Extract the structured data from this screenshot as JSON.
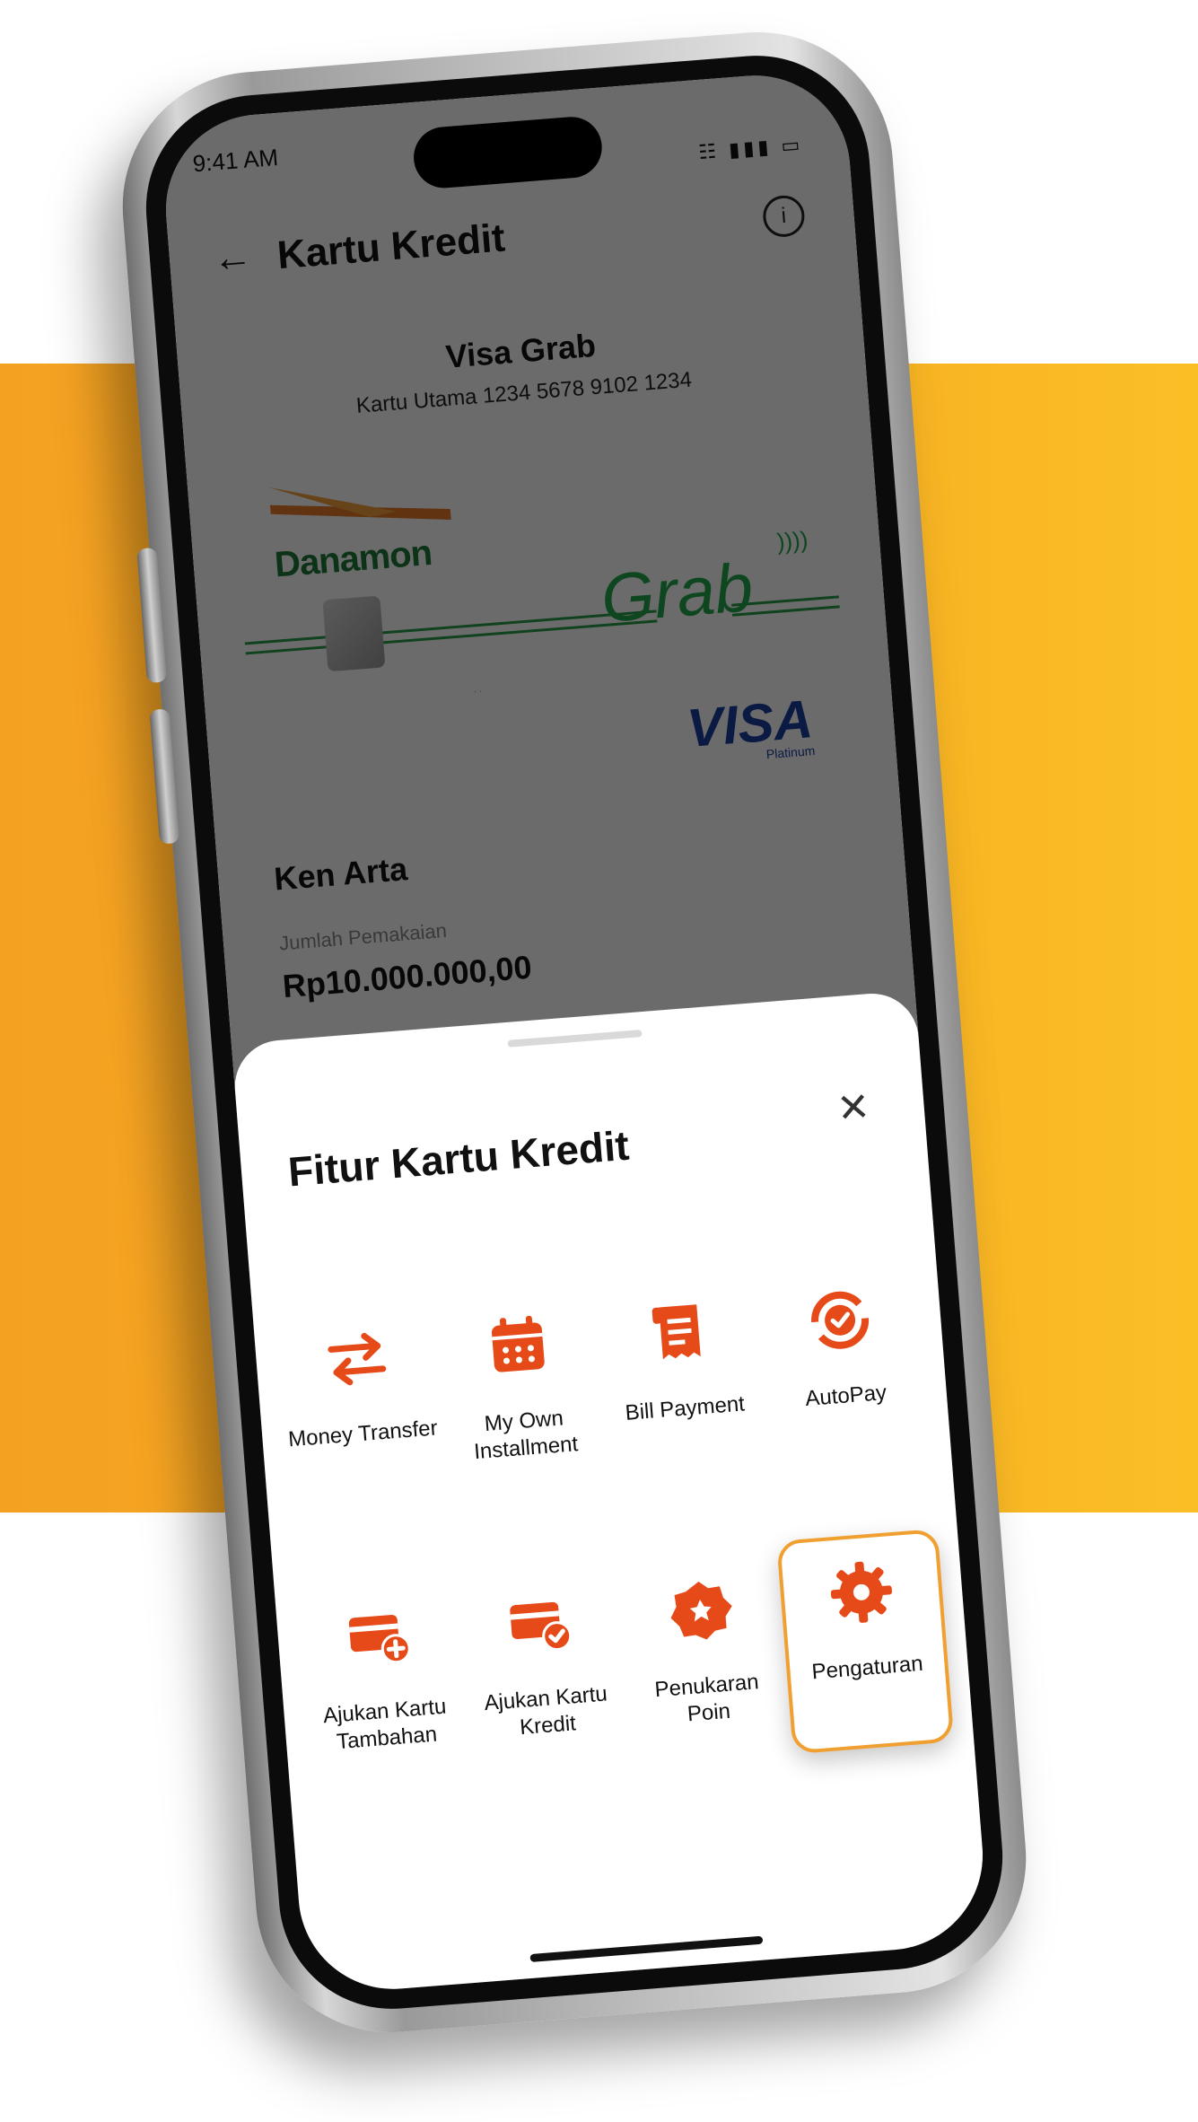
{
  "colors": {
    "accent": "#e64a19",
    "highlight": "#f0a030",
    "background": "#f7ab20"
  },
  "status_bar": {
    "time": "9:41 AM",
    "icons": "wifi-signal-battery"
  },
  "header": {
    "title": "Kartu Kredit",
    "back_icon": "back-arrow-icon",
    "info_icon": "info-icon"
  },
  "card": {
    "name": "Visa Grab",
    "number": "Kartu Utama 1234 5678 9102 1234",
    "bank_logo_text": "Danamon",
    "partner_logo_text": "Grab",
    "network_logo_text": "VISA",
    "network_tier": "Platinum"
  },
  "account": {
    "holder": "Ken Arta",
    "usage_label": "Jumlah Pemakaian",
    "usage_value": "Rp10.000.000,00"
  },
  "sheet": {
    "title": "Fitur Kartu Kredit",
    "close_icon": "close-icon",
    "features": [
      {
        "label": "Money Transfer",
        "icon": "transfer-arrows-icon"
      },
      {
        "label": "My Own\nInstallment",
        "icon": "calendar-icon"
      },
      {
        "label": "Bill Payment",
        "icon": "receipt-icon"
      },
      {
        "label": "AutoPay",
        "icon": "autopay-icon"
      },
      {
        "label": "Ajukan Kartu\nTambahan",
        "icon": "add-card-icon"
      },
      {
        "label": "Ajukan Kartu\nKredit",
        "icon": "card-check-icon"
      },
      {
        "label": "Penukaran\nPoin",
        "icon": "badge-icon"
      },
      {
        "label": "Pengaturan",
        "icon": "gear-icon",
        "selected": true
      }
    ]
  }
}
